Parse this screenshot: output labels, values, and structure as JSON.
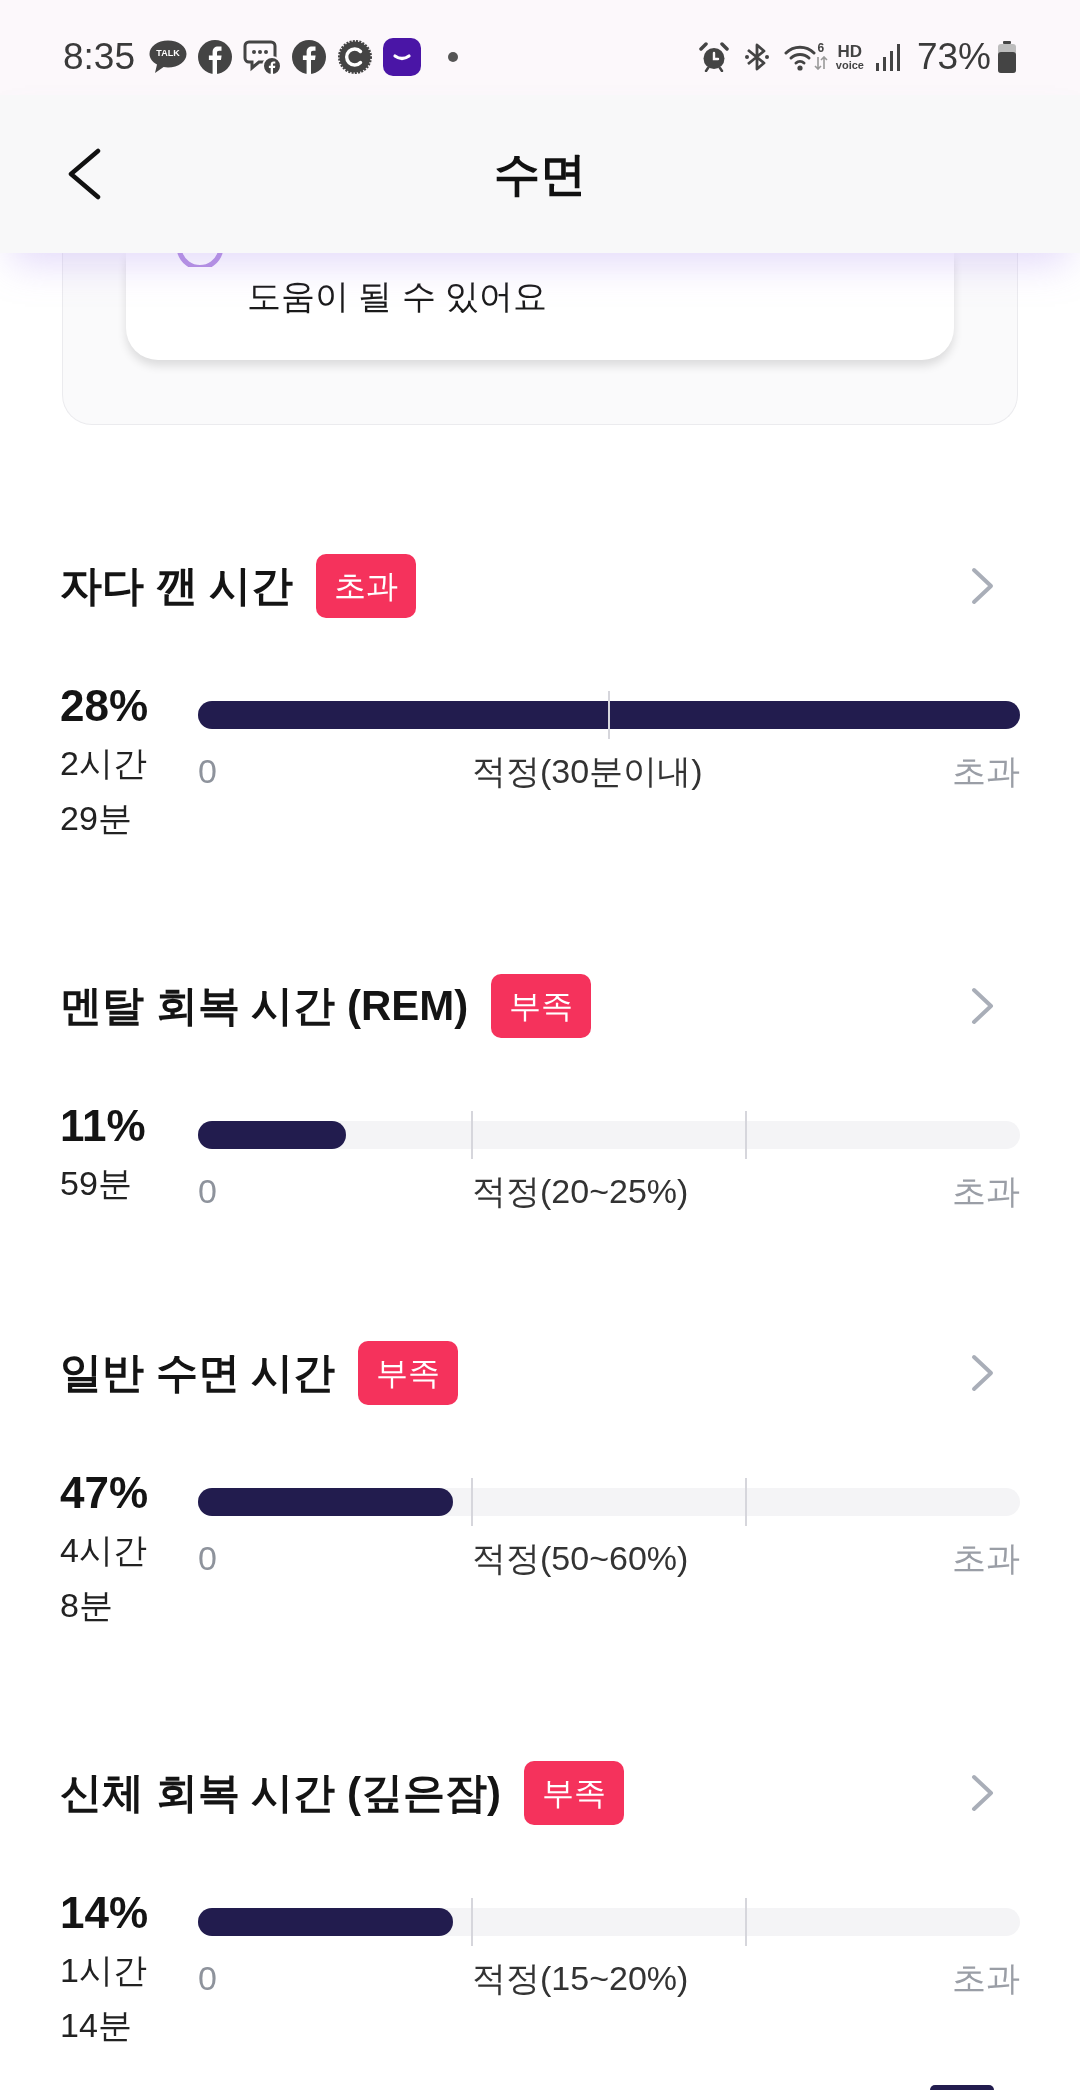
{
  "status_bar": {
    "time": "8:35",
    "talk_label": "TALK",
    "wifi_label": "6",
    "hd_label": "HD",
    "voice_label": "voice",
    "battery": "73%"
  },
  "header": {
    "title": "수면"
  },
  "tip_card": {
    "text": "도움이 될 수 있어요"
  },
  "sections": [
    {
      "title": "자다 깬 시간",
      "badge": "초과",
      "percent": "28%",
      "duration": "2시간 29분",
      "level": 1,
      "kind": "limit",
      "scale": {
        "start": "0",
        "middle": "적정(30분이내)",
        "end": "초과"
      }
    },
    {
      "title": "멘탈 회복 시간 (REM)",
      "badge": "부족",
      "percent": "11%",
      "duration": "59분",
      "level": 0.18,
      "kind": "range",
      "scale": {
        "start": "0",
        "middle": "적정(20~25%)",
        "end": "초과"
      }
    },
    {
      "title": "일반 수면 시간",
      "badge": "부족",
      "percent": "47%",
      "duration": "4시간 8분",
      "level": 0.31,
      "kind": "range",
      "scale": {
        "start": "0",
        "middle": "적정(50~60%)",
        "end": "초과"
      }
    },
    {
      "title": "신체 회복 시간 (깊은잠)",
      "badge": "부족",
      "percent": "14%",
      "duration": "1시간 14분",
      "level": 0.31,
      "kind": "range",
      "scale": {
        "start": "0",
        "middle": "적정(15~20%)",
        "end": "초과"
      }
    }
  ]
}
